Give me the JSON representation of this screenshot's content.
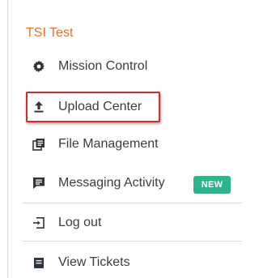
{
  "menu": {
    "title": "TSI Test",
    "items": [
      {
        "label": "Mission Control",
        "icon": "gear-icon"
      },
      {
        "label": "Upload Center",
        "icon": "upload-icon"
      },
      {
        "label": "File Management",
        "icon": "file-stack-icon"
      },
      {
        "label": "Messaging Activity",
        "icon": "message-icon",
        "badge": "NEW"
      },
      {
        "label": "Log out",
        "icon": "logout-icon"
      },
      {
        "label": "View Tickets",
        "icon": "ticket-icon"
      }
    ]
  },
  "colors": {
    "title": "#e8702a",
    "text": "#3d3d3d",
    "icon": "#2f3640",
    "badge": "#2bb58a",
    "highlight_border": "#d62b2b"
  }
}
